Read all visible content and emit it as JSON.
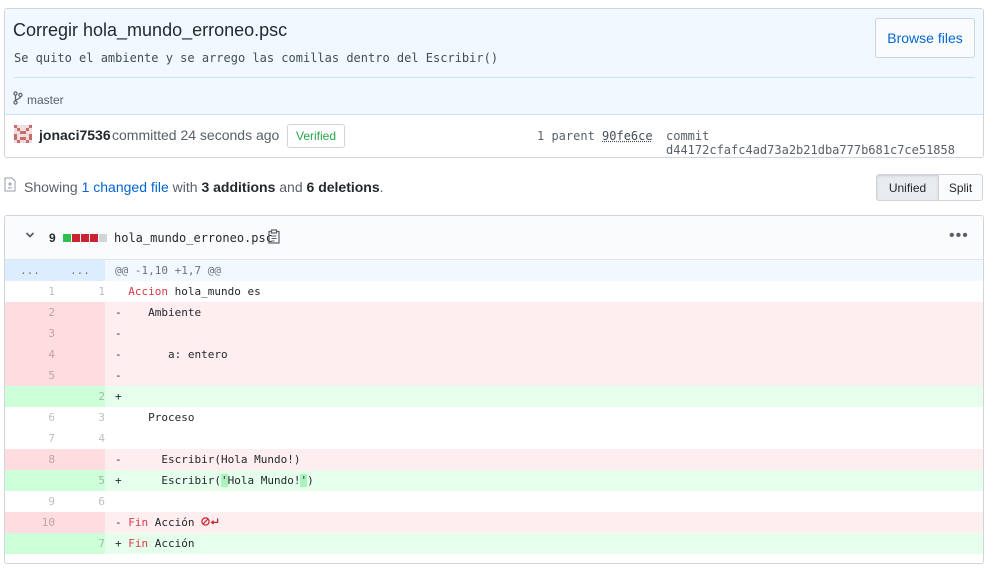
{
  "commit": {
    "title": "Corregir hola_mundo_erroneo.psc",
    "description": "Se quito el ambiente y se arrego las comillas dentro del Escribir()",
    "browse_label": "Browse files",
    "branch": "master",
    "author": "jonaci7536",
    "committed_text": "committed 24 seconds ago",
    "verified_label": "Verified",
    "parent_label": "1 parent",
    "parent_sha": "90fe6ce",
    "commit_label": "commit",
    "commit_sha": "d44172cfafc4ad73a2b21dba777b681c7ce51858"
  },
  "toc": {
    "showing": "Showing",
    "changed": "1 changed file",
    "with": "with",
    "additions": "3 additions",
    "and": "and",
    "deletions": "6 deletions",
    "period": ".",
    "unified_label": "Unified",
    "split_label": "Split"
  },
  "file": {
    "change_count": "9",
    "name": "hola_mundo_erroneo.psc",
    "more": "•••",
    "hunk_left": "...",
    "hunk_right": "...",
    "hunk_header": "@@ -1,10 +1,7 @@"
  },
  "diff": [
    {
      "type": "ctx",
      "old": "1",
      "new": "1",
      "prefix": " ",
      "kw": "Accion",
      "text": " hola_mundo es"
    },
    {
      "type": "del",
      "old": "2",
      "new": "",
      "prefix": "-",
      "kw": "",
      "text": "   Ambiente"
    },
    {
      "type": "del",
      "old": "3",
      "new": "",
      "prefix": "-",
      "kw": "",
      "text": ""
    },
    {
      "type": "del",
      "old": "4",
      "new": "",
      "prefix": "-",
      "kw": "",
      "text": "      a: entero"
    },
    {
      "type": "del",
      "old": "5",
      "new": "",
      "prefix": "-",
      "kw": "",
      "text": ""
    },
    {
      "type": "add",
      "old": "",
      "new": "2",
      "prefix": "+",
      "kw": "",
      "text": ""
    },
    {
      "type": "ctx",
      "old": "6",
      "new": "3",
      "prefix": " ",
      "kw": "",
      "text": "   Proceso"
    },
    {
      "type": "ctx",
      "old": "7",
      "new": "4",
      "prefix": " ",
      "kw": "",
      "text": ""
    },
    {
      "type": "del",
      "old": "8",
      "new": "",
      "prefix": "-",
      "kw": "",
      "text": "     Escribir(Hola Mundo!)"
    },
    {
      "type": "add",
      "old": "",
      "new": "5",
      "prefix": "+",
      "kw": "",
      "text": "     Escribir(",
      "hl1": "'",
      "mid": "Hola Mundo!",
      "hl2": "'",
      "end": ")"
    },
    {
      "type": "ctx",
      "old": "9",
      "new": "6",
      "prefix": " ",
      "kw": "",
      "text": ""
    },
    {
      "type": "del",
      "old": "10",
      "new": "",
      "prefix": "-",
      "kw": "Fin",
      "text": " Acción",
      "noeol": true
    },
    {
      "type": "add",
      "old": "",
      "new": "7",
      "prefix": "+",
      "kw": "Fin",
      "text": " Acción"
    }
  ],
  "colors": {
    "added": "#2cbe4e",
    "deleted": "#cb2431",
    "neutral": "#d1d5da",
    "link": "#0366d6"
  }
}
